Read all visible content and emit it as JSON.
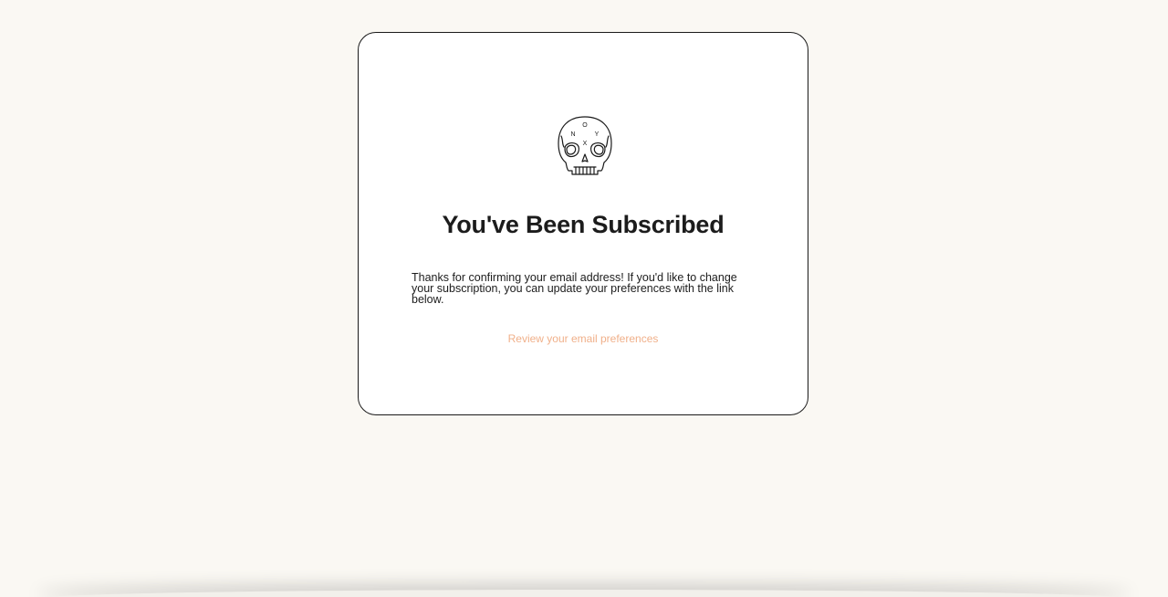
{
  "logo": {
    "icon": "skull-icon",
    "letters": [
      "O",
      "N",
      "Y",
      "X"
    ]
  },
  "title": "You've Been Subscribed",
  "message": "Thanks for confirming your email address! If you'd like to change your subscription, you can update your preferences with the link below.",
  "link": {
    "label": "Review your email preferences"
  },
  "colors": {
    "background": "#faf8f3",
    "card": "#ffffff",
    "link": "#f0b08a",
    "text": "#1c1c1c"
  }
}
